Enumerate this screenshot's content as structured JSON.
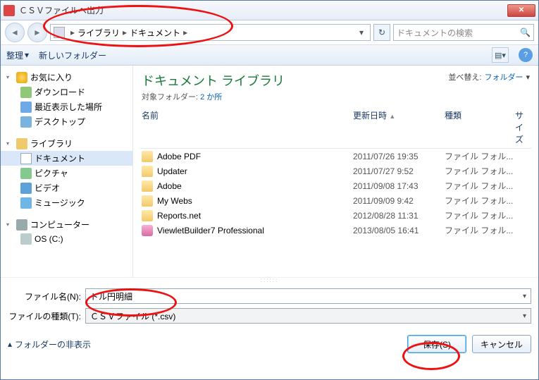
{
  "title": "ＣＳＶファイルへ出力",
  "breadcrumb": {
    "root": "ライブラリ",
    "current": "ドキュメント"
  },
  "search": {
    "placeholder": "ドキュメントの検索"
  },
  "toolbar": {
    "organize": "整理",
    "new_folder": "新しいフォルダー"
  },
  "sidebar": {
    "fav": {
      "label": "お気に入り",
      "items": [
        "ダウンロード",
        "最近表示した場所",
        "デスクトップ"
      ]
    },
    "lib": {
      "label": "ライブラリ",
      "items": [
        "ドキュメント",
        "ピクチャ",
        "ビデオ",
        "ミュージック"
      ]
    },
    "comp": {
      "label": "コンピューター",
      "items": [
        "OS (C:)"
      ]
    }
  },
  "library": {
    "title": "ドキュメント ライブラリ",
    "subject_label": "対象フォルダー:",
    "subject_count": "2 か所",
    "sort_label": "並べ替え:",
    "sort_value": "フォルダー"
  },
  "columns": {
    "name": "名前",
    "date": "更新日時",
    "type": "種類",
    "size": "サイズ"
  },
  "files": [
    {
      "n": "Adobe PDF",
      "d": "2011/07/26 19:35",
      "t": "ファイル フォル...",
      "k": "fldr"
    },
    {
      "n": "Updater",
      "d": "2011/07/27 9:52",
      "t": "ファイル フォル...",
      "k": "fldr"
    },
    {
      "n": "Adobe",
      "d": "2011/09/08 17:43",
      "t": "ファイル フォル...",
      "k": "fldr"
    },
    {
      "n": "My Webs",
      "d": "2011/09/09 9:42",
      "t": "ファイル フォル...",
      "k": "fldr"
    },
    {
      "n": "Reports.net",
      "d": "2012/08/28 11:31",
      "t": "ファイル フォル...",
      "k": "fldr"
    },
    {
      "n": "ViewletBuilder7 Professional",
      "d": "2013/08/05 16:41",
      "t": "ファイル フォル...",
      "k": "finst"
    }
  ],
  "form": {
    "filename_label": "ファイル名(N):",
    "filename_value": "ドル円明細",
    "filetype_label": "ファイルの種類(T):",
    "filetype_value": "ＣＳＶファイル (*.csv)"
  },
  "footer": {
    "hide_folders": "フォルダーの非表示",
    "save": "保存(S)",
    "cancel": "キャンセル"
  }
}
